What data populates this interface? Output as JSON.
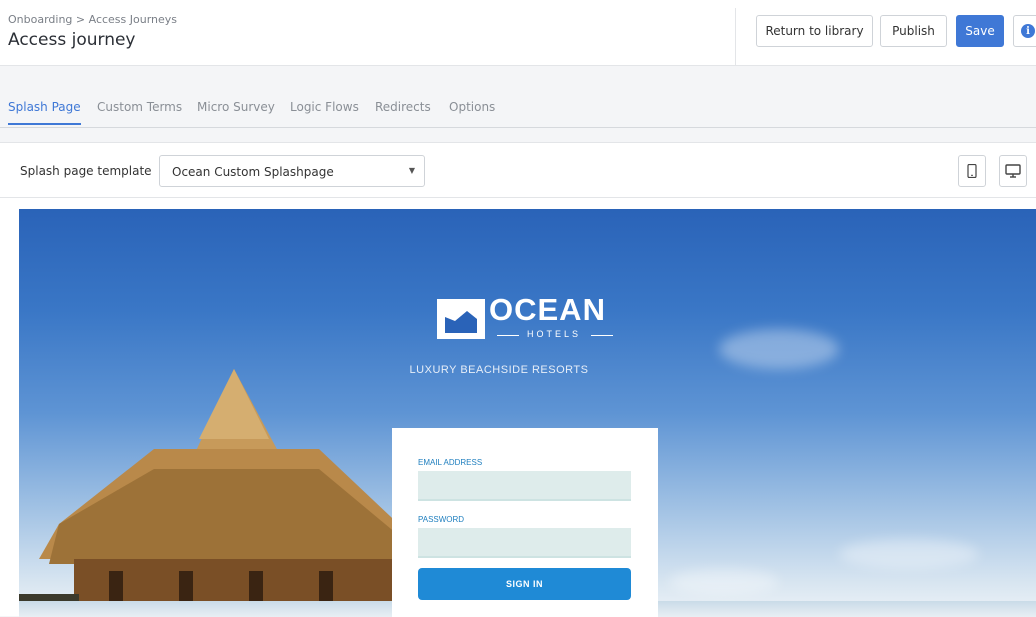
{
  "header": {
    "breadcrumb": "Onboarding > Access Journeys",
    "title": "Access journey",
    "return_label": "Return to library",
    "publish_label": "Publish",
    "save_label": "Save",
    "info_glyph": "i",
    "accent_color": "#3f78d6"
  },
  "tabs": [
    {
      "label": "Splash Page",
      "active": true
    },
    {
      "label": "Custom Terms",
      "active": false
    },
    {
      "label": "Micro Survey",
      "active": false
    },
    {
      "label": "Logic Flows",
      "active": false
    },
    {
      "label": "Redirects",
      "active": false
    },
    {
      "label": "Options",
      "active": false
    }
  ],
  "toolbar": {
    "template_label": "Splash page template",
    "template_value": "Ocean Custom Splashpage",
    "caret": "▼",
    "mobile_icon": "mobile-device-icon",
    "desktop_icon": "desktop-monitor-icon"
  },
  "preview": {
    "brand_name": "OCEAN",
    "brand_sub": "HOTELS",
    "tagline": "LUXURY BEACHSIDE RESORTS",
    "email_label": "EMAIL ADDRESS",
    "email_value": "",
    "password_label": "PASSWORD",
    "password_value": "",
    "signin_label": "SIGN IN",
    "button_color": "#1f8ad6"
  }
}
